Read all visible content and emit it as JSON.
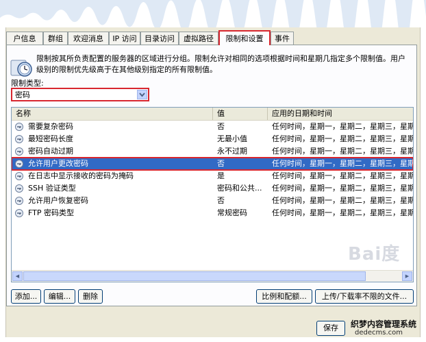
{
  "tabs": [
    {
      "label": "户信息"
    },
    {
      "label": "群组"
    },
    {
      "label": "欢迎消息"
    },
    {
      "label": "IP 访问"
    },
    {
      "label": "目录访问"
    },
    {
      "label": "虚拟路径"
    },
    {
      "label": "限制和设置",
      "active": true
    },
    {
      "label": "事件"
    }
  ],
  "description": "限制按其所负责配置的服务器的区域进行分组。限制允许对相同的选项根据时间和星期几指定多个限制值。用户级别的限制优先级高于在其他级别指定的所有限制值。",
  "limit_type": {
    "label": "限制类型:",
    "value": "密码"
  },
  "list": {
    "columns": [
      "名称",
      "值",
      "应用的日期和时间"
    ],
    "rows": [
      {
        "name": "需要复杂密码",
        "value": "否",
        "when": "任何时间，星期一，星期二，星期三，星期四",
        "selected": false
      },
      {
        "name": "最短密码长度",
        "value": "无最小值",
        "when": "任何时间，星期一，星期二，星期三，星期四",
        "selected": false
      },
      {
        "name": "密码自动过期",
        "value": "永不过期",
        "when": "任何时间，星期一，星期二，星期三，星期四",
        "selected": false
      },
      {
        "name": "允许用户更改密码",
        "value": "否",
        "when": "任何时间，星期一，星期二，星期三，星期四",
        "selected": true
      },
      {
        "name": "在日志中显示接收的密码为掩码",
        "value": "是",
        "when": "任何时间，星期一，星期二，星期三，星期四",
        "selected": false
      },
      {
        "name": "SSH 验证类型",
        "value": "密码和公共...",
        "when": "任何时间，星期一，星期二，星期三，星期四",
        "selected": false
      },
      {
        "name": "允许用户恢复密码",
        "value": "否",
        "when": "任何时间，星期一，星期二，星期三，星期四",
        "selected": false
      },
      {
        "name": "FTP 密码类型",
        "value": "常规密码",
        "when": "任何时间，星期一，星期二，星期三，星期四",
        "selected": false
      }
    ]
  },
  "buttons": {
    "add": "添加...",
    "edit": "编辑...",
    "delete": "删除",
    "ratio": "比例和配额...",
    "upload": "上传/下载率不限的文件..."
  },
  "footer": {
    "partial_button": "保存"
  },
  "watermark": {
    "line1": "织梦内容管理系统",
    "line2": "dedecms.com",
    "baidu": "Bai度"
  },
  "colors": {
    "highlight_red": "#d8262e",
    "selection_blue": "#316ac5",
    "dialog_bg": "#ece9d8"
  }
}
